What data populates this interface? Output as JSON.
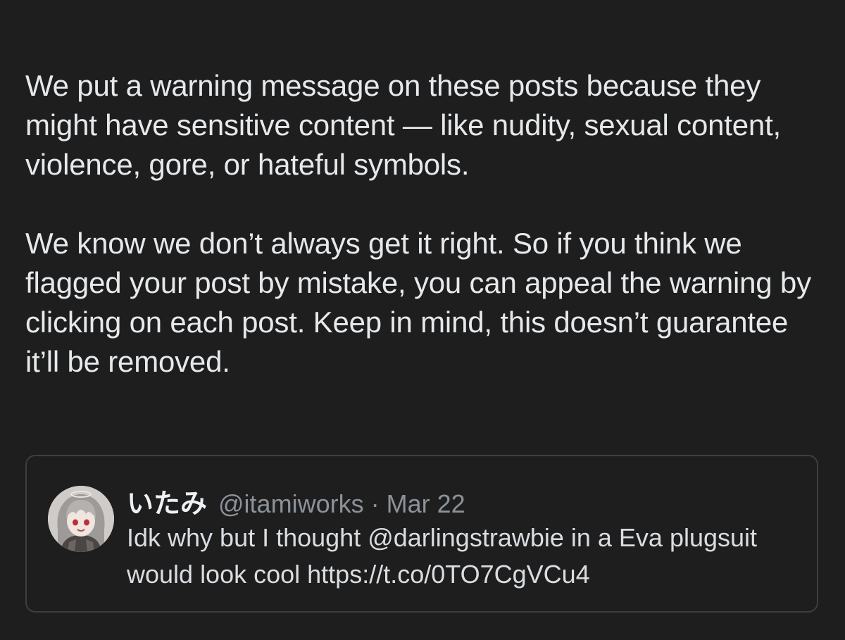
{
  "notice": {
    "paragraph1": "We put a warning message on these posts because they might have sensitive content — like nudity, sexual content, violence, gore, or hateful symbols.",
    "paragraph2": "We know we don’t always get it right. So if you think we flagged your post by mistake, you can appeal the warning by clicking on each post. Keep in mind, this doesn’t guarantee it’ll be removed."
  },
  "quoted_tweet": {
    "display_name": "いたみ",
    "handle": "@itamiworks",
    "separator": "·",
    "date": "Mar 22",
    "text": "Idk why but I thought @darlingstrawbie in a Eva plugsuit would look cool https://t.co/0TO7CgVCu4",
    "avatar_icon": "anime-avatar-icon"
  },
  "colors": {
    "background": "#1e1e1e",
    "text_primary": "#e6e9ec",
    "text_secondary": "#8b9299",
    "card_border": "#3b3f43"
  }
}
